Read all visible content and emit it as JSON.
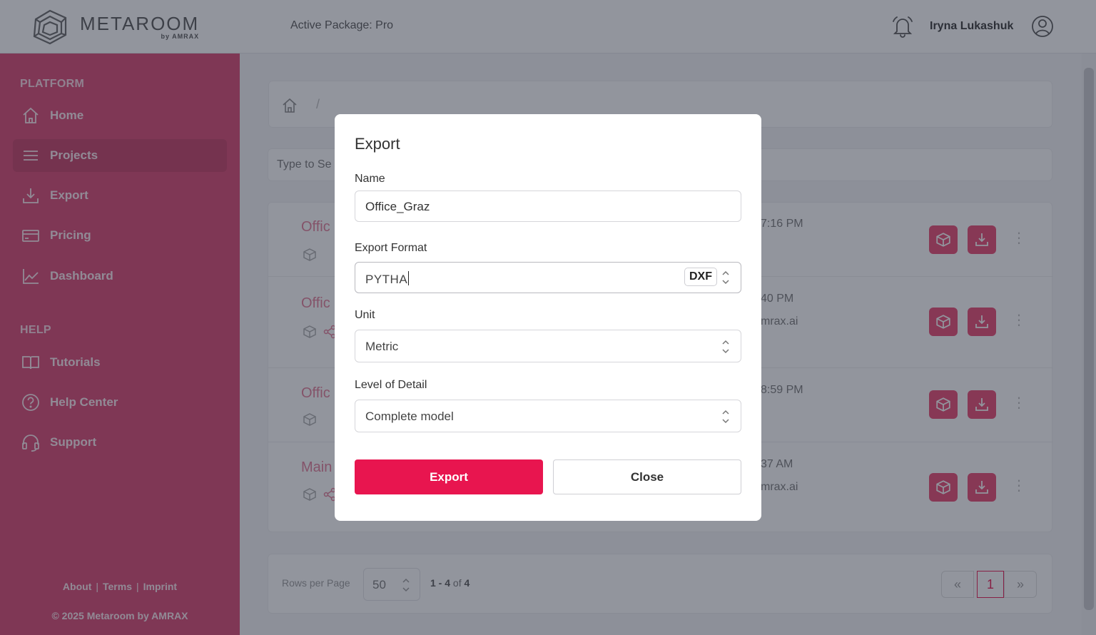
{
  "header": {
    "logo_word": "METAROOM",
    "logo_sub": "by AMRAX",
    "active_package": "Active Package: Pro",
    "user_name": "Iryna Lukashuk"
  },
  "sidebar": {
    "platform_title": "PLATFORM",
    "help_title": "HELP",
    "platform_items": [
      {
        "label": "Home",
        "icon": "home-icon"
      },
      {
        "label": "Projects",
        "icon": "list-icon"
      },
      {
        "label": "Export",
        "icon": "download-icon"
      },
      {
        "label": "Pricing",
        "icon": "card-icon"
      },
      {
        "label": "Dashboard",
        "icon": "chart-icon"
      }
    ],
    "help_items": [
      {
        "label": "Tutorials",
        "icon": "book-icon"
      },
      {
        "label": "Help Center",
        "icon": "question-icon"
      },
      {
        "label": "Support",
        "icon": "headset-icon"
      }
    ],
    "links": {
      "about": "About",
      "terms": "Terms",
      "imprint": "Imprint"
    },
    "copyright": "© 2025 Metaroom by AMRAX"
  },
  "main": {
    "search_placeholder": "Type to Se",
    "rows": [
      {
        "title": "Offic",
        "time": "7:16 PM",
        "email": ""
      },
      {
        "title": "Offic",
        "time": "40 PM",
        "email": "mrax.ai"
      },
      {
        "title": "Offic",
        "time": "8:59 PM",
        "email": ""
      },
      {
        "title": "Main",
        "time": "37 AM",
        "email": "mrax.ai"
      }
    ],
    "pager": {
      "rows_label": "Rows per Page",
      "rows_value": "50",
      "range_start": "1",
      "range_sep": " - ",
      "range_end": "4",
      "range_of": " of ",
      "range_total": "4",
      "prev": "«",
      "page": "1",
      "next": "»"
    }
  },
  "modal": {
    "title": "Export",
    "name_label": "Name",
    "name_value": "Office_Graz",
    "format_label": "Export Format",
    "format_value": "PYTHA",
    "format_badge": "DXF",
    "unit_label": "Unit",
    "unit_value": "Metric",
    "detail_label": "Level of Detail",
    "detail_value": "Complete model",
    "export_button": "Export",
    "close_button": "Close"
  },
  "colors": {
    "brand_pink": "#e8154f",
    "sidebar": "#d9426f"
  }
}
